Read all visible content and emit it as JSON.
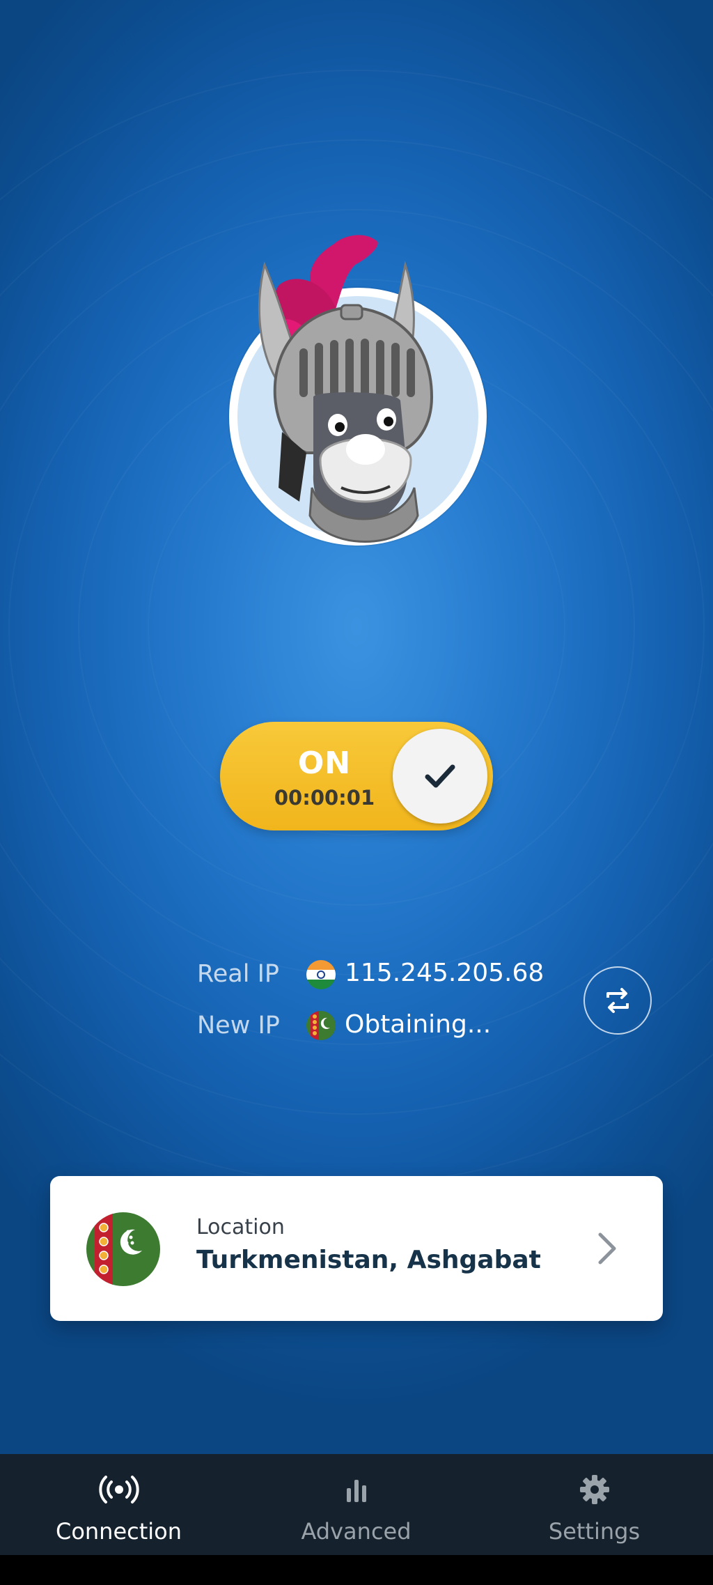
{
  "connection": {
    "status_label": "ON",
    "timer": "00:00:01"
  },
  "ip_info": {
    "real_ip_label": "Real IP",
    "real_ip_value": "115.245.205.68",
    "real_ip_flag": "india-flag-icon",
    "new_ip_label": "New IP",
    "new_ip_value": "Obtaining...",
    "new_ip_flag": "turkmenistan-flag-icon"
  },
  "location": {
    "label": "Location",
    "value": "Turkmenistan, Ashgabat",
    "flag": "turkmenistan-flag-icon"
  },
  "nav": {
    "items": [
      {
        "label": "Connection",
        "icon": "broadcast-icon",
        "active": true
      },
      {
        "label": "Advanced",
        "icon": "bar-chart-icon",
        "active": false
      },
      {
        "label": "Settings",
        "icon": "gear-icon",
        "active": false
      }
    ]
  },
  "colors": {
    "background_blue": "#2a7fd2",
    "toggle_yellow": "#f4bd25",
    "nav_background": "#15212c",
    "card_text": "#163349"
  }
}
